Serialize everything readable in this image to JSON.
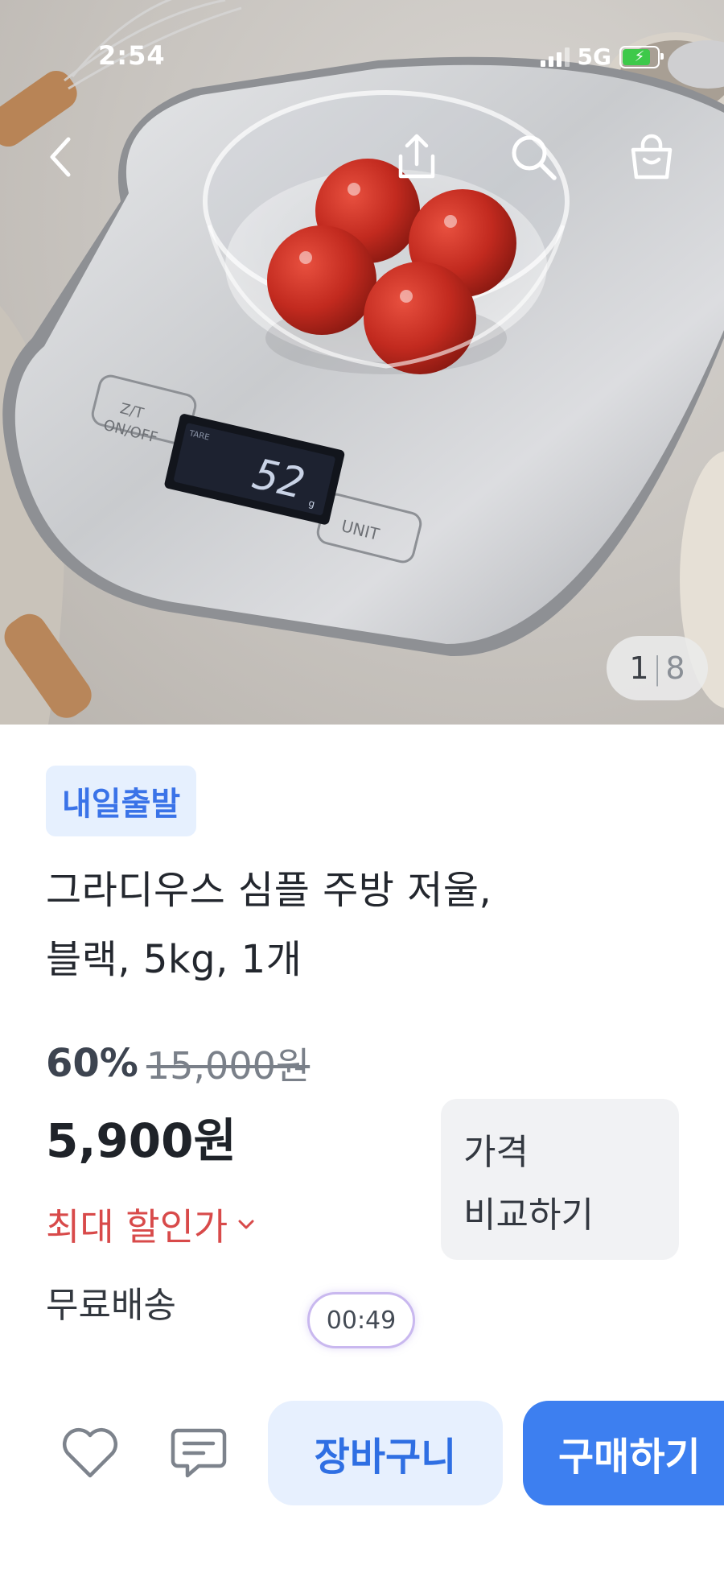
{
  "status_bar": {
    "time": "2:54",
    "network": "5G"
  },
  "gallery": {
    "current": "1",
    "total": "8",
    "scale_display": "52"
  },
  "product": {
    "badge": "내일출발",
    "title_line1": "그라디우스 심플 주방 저울,",
    "title_line2": "블랙, 5kg, 1개",
    "discount": "60%",
    "original_price": "15,000원",
    "price": "5,900원",
    "max_discount": "최대 할인가",
    "shipping": "무료배송"
  },
  "compare": {
    "line1": "가격",
    "line2": "비교하기"
  },
  "timer": "00:49",
  "actions": {
    "cart": "장바구니",
    "buy": "구매하기"
  },
  "colors": {
    "accent": "#3d7ff0",
    "badge_text": "#3a73e8",
    "sale_red": "#d84a4a"
  }
}
